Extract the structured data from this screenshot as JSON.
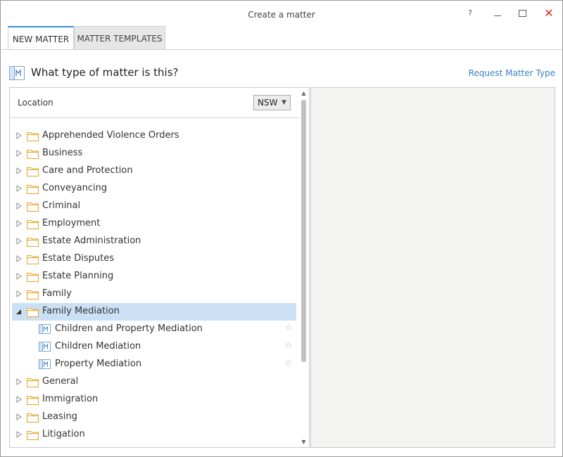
{
  "window": {
    "title": "Create a matter",
    "help": "?",
    "close": "✕"
  },
  "tabs": [
    {
      "label": "NEW MATTER",
      "active": true
    },
    {
      "label": "MATTER TEMPLATES",
      "active": false
    }
  ],
  "header": {
    "title": "What type of matter is this?",
    "request_link": "Request Matter Type"
  },
  "location": {
    "label": "Location",
    "selected": "NSW"
  },
  "tree": {
    "items": [
      {
        "label": "Apprehended Violence Orders"
      },
      {
        "label": "Business"
      },
      {
        "label": "Care and Protection"
      },
      {
        "label": "Conveyancing"
      },
      {
        "label": "Criminal"
      },
      {
        "label": "Employment"
      },
      {
        "label": "Estate Administration"
      },
      {
        "label": "Estate Disputes"
      },
      {
        "label": "Estate Planning"
      },
      {
        "label": "Family"
      },
      {
        "label": "Family Mediation",
        "expanded": true,
        "selected": true
      },
      {
        "label": "General"
      },
      {
        "label": "Immigration"
      },
      {
        "label": "Leasing"
      },
      {
        "label": "Litigation"
      }
    ],
    "family_mediation_children": [
      {
        "label": "Children and Property Mediation"
      },
      {
        "label": "Children Mediation"
      },
      {
        "label": "Property Mediation"
      }
    ]
  },
  "colors": {
    "accent": "#3a8fd8",
    "link": "#3a7fc4",
    "folder": "#e8a21c",
    "selection": "#cce0f5",
    "close": "#e0241c"
  },
  "icons": {
    "folder": "folder-icon",
    "matter": "matter-type-icon",
    "favorite": "star-icon"
  }
}
